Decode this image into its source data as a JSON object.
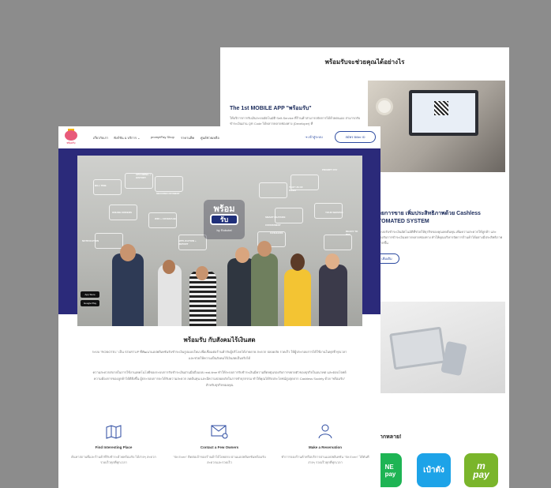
{
  "back_page": {
    "section_title": "พร้อมรับจะช่วยคุณได้อย่างไร",
    "feature1_title": "The 1st MOBILE APP \"พร้อมรับ\"",
    "feature1_text": "ให้บริการการรับเงินระบบอัตโนมัติ Self-Service ที่ร้านค้าสามารถจัดการได้ด้วยตนเอง สามารถรับชำระเงินผ่าน QR Code ได้หลากหลายช่องทาง (Developer) ที่",
    "feature2_title": "วยการขาย เพิ่มประสิทธิภาพด้วย Cashless\nTOMATED SYSTEM",
    "feature2_text": "ระบบรับชำระเงินอัตโนมัติที่ช่วยให้ธุรกิจของคุณลดต้นทุน เพิ่มความสะดวกให้ลูกค้า และรองรับการชำระเงินหลากหลายช่องทาง ทำให้คุณบริหารจัดการร้านค้าได้อย่างมีประสิทธิภาพมากขึ้น",
    "feature2_button": "เพิ่มเติม",
    "payments_title": "ากหลาย!",
    "payments": [
      "NE\npay",
      "เป๋าตัง",
      "m\npay"
    ]
  },
  "nav": {
    "logo_text": "พร้อมรับ",
    "items": [
      "เกี่ยวกับเรา",
      "ฟังก์ชัน & บริการ ⌄",
      "promptPay Shop",
      "ราคาแพ็ค",
      "ศูนย์ช่วยเหลือ"
    ],
    "login": "เข้าสู่ระบบ",
    "cta_button": "สมัคร Biller ID"
  },
  "hero": {
    "brand_top": "พร้อม",
    "brand_mid": "รับ",
    "brand_bottom": "by Robotel",
    "labels": [
      "BILL TIME",
      "UPCOMING + HISTORY",
      "SECURED PAYMENT",
      "ONLINE ORDERS",
      "WIFI + COVERAGE",
      "TEXT US OF WEEK",
      "NOTIFICATION",
      "APPLICATION + REPORT",
      "SMART FEATURE",
      "CONVENIENT",
      "CASHLESS",
      "YOUR SERVICE",
      "READY TO PAY",
      "PROMPT PAY"
    ],
    "store_app": "App Store",
    "store_play": "Google Play"
  },
  "intro": {
    "title": "พร้อมรับ  กับสังคมไร้เงินสด",
    "para1": "ระบบ \"ROBOTEL\" เป็น STARTUP ที่พัฒนาแอปพลิเคชันรับชำระเงินรูปแบบใหม่ เพื่อเชื่อมต่อร้านค้ากับผู้บริโภคได้ง่ายดาย สะดวก ปลอดภัย รวดเร็ว ให้ผู้ประกอบการได้ใช้งานในทุกที่ ทุกเวลา และช่วยให้ความเป็นสังคมไร้เงินสดเป็นจริงได้",
    "para2": "ความสะดวกสบายในการใช้งานเทคโนโลยีของระบบการรับชำระเงินผ่านมือถือแบบ real-time ทำให้ระบบการรับชำระเงินมีความยืดหยุ่นรองรับการขยายตัวของธุรกิจในอนาคต และตอบโจทย์ความต้องการของลูกค้าได้ดียิ่งขึ้น ผู้ประกอบการจะได้รับความสะดวก ลดต้นทุน และมีความปลอดภัยในการทำธุรกรรม ทำให้คุณได้รับประโยชน์สูงสุดจาก Cashless Society ด้วย \"พร้อมรับ\" สำหรับธุรกิจของคุณ"
  },
  "features": [
    {
      "icon": "map-icon",
      "title": "Find Interesting Place",
      "text": "ค้นหาสถานที่และร้านค้าที่รับชำระด้วยพร้อมรับ ได้ง่ายๆ สะดวก รวดเร็วทุกที่ทุกเวลา"
    },
    {
      "icon": "mail-icon",
      "title": "Contact a Few Owners",
      "text": "\"Sit Even\" ติดต่อเจ้าของร้านค้าได้โดยตรง ผ่านแอปพลิเคชันพร้อมรับ สะดวกและรวดเร็ว"
    },
    {
      "icon": "person-icon",
      "title": "Make a Reservation",
      "text": "ทำการจองร้านค้าหรือบริการผ่านแอปพลิเคชัน \"Sit Even\" ได้ทันที ง่ายๆ รวดเร็วทุกที่ทุกเวลา"
    }
  ],
  "colors": {
    "brand_navy": "#2b2a7a",
    "accent_blue": "#2b4aa0",
    "logo_pink": "#e85a7a",
    "line_green": "#1eb454",
    "pao_blue": "#1da3e8",
    "mpay_green": "#7ab52b"
  }
}
